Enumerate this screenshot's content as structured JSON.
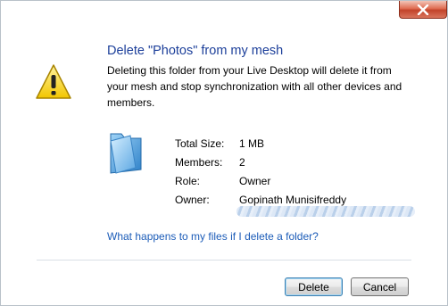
{
  "dialog": {
    "title": "Delete \"Photos\" from my mesh",
    "message": "Deleting this folder from your Live Desktop will delete it from your mesh and stop synchronization with all other devices and members.",
    "warning_icon": "warning-triangle-icon",
    "folder_icon": "folder-icon",
    "close_icon": "close-icon"
  },
  "info": {
    "total_size_label": "Total Size:",
    "total_size_value": "1 MB",
    "members_label": "Members:",
    "members_value": "2",
    "role_label": "Role:",
    "role_value": "Owner",
    "owner_label": "Owner:",
    "owner_value": "Gopinath Munisifreddy"
  },
  "help_link": "What happens to my files if I delete a folder?",
  "buttons": {
    "delete": "Delete",
    "cancel": "Cancel"
  },
  "colors": {
    "title": "#1c3f9a",
    "link": "#1c5cb8",
    "close_button": "#c2432a"
  }
}
